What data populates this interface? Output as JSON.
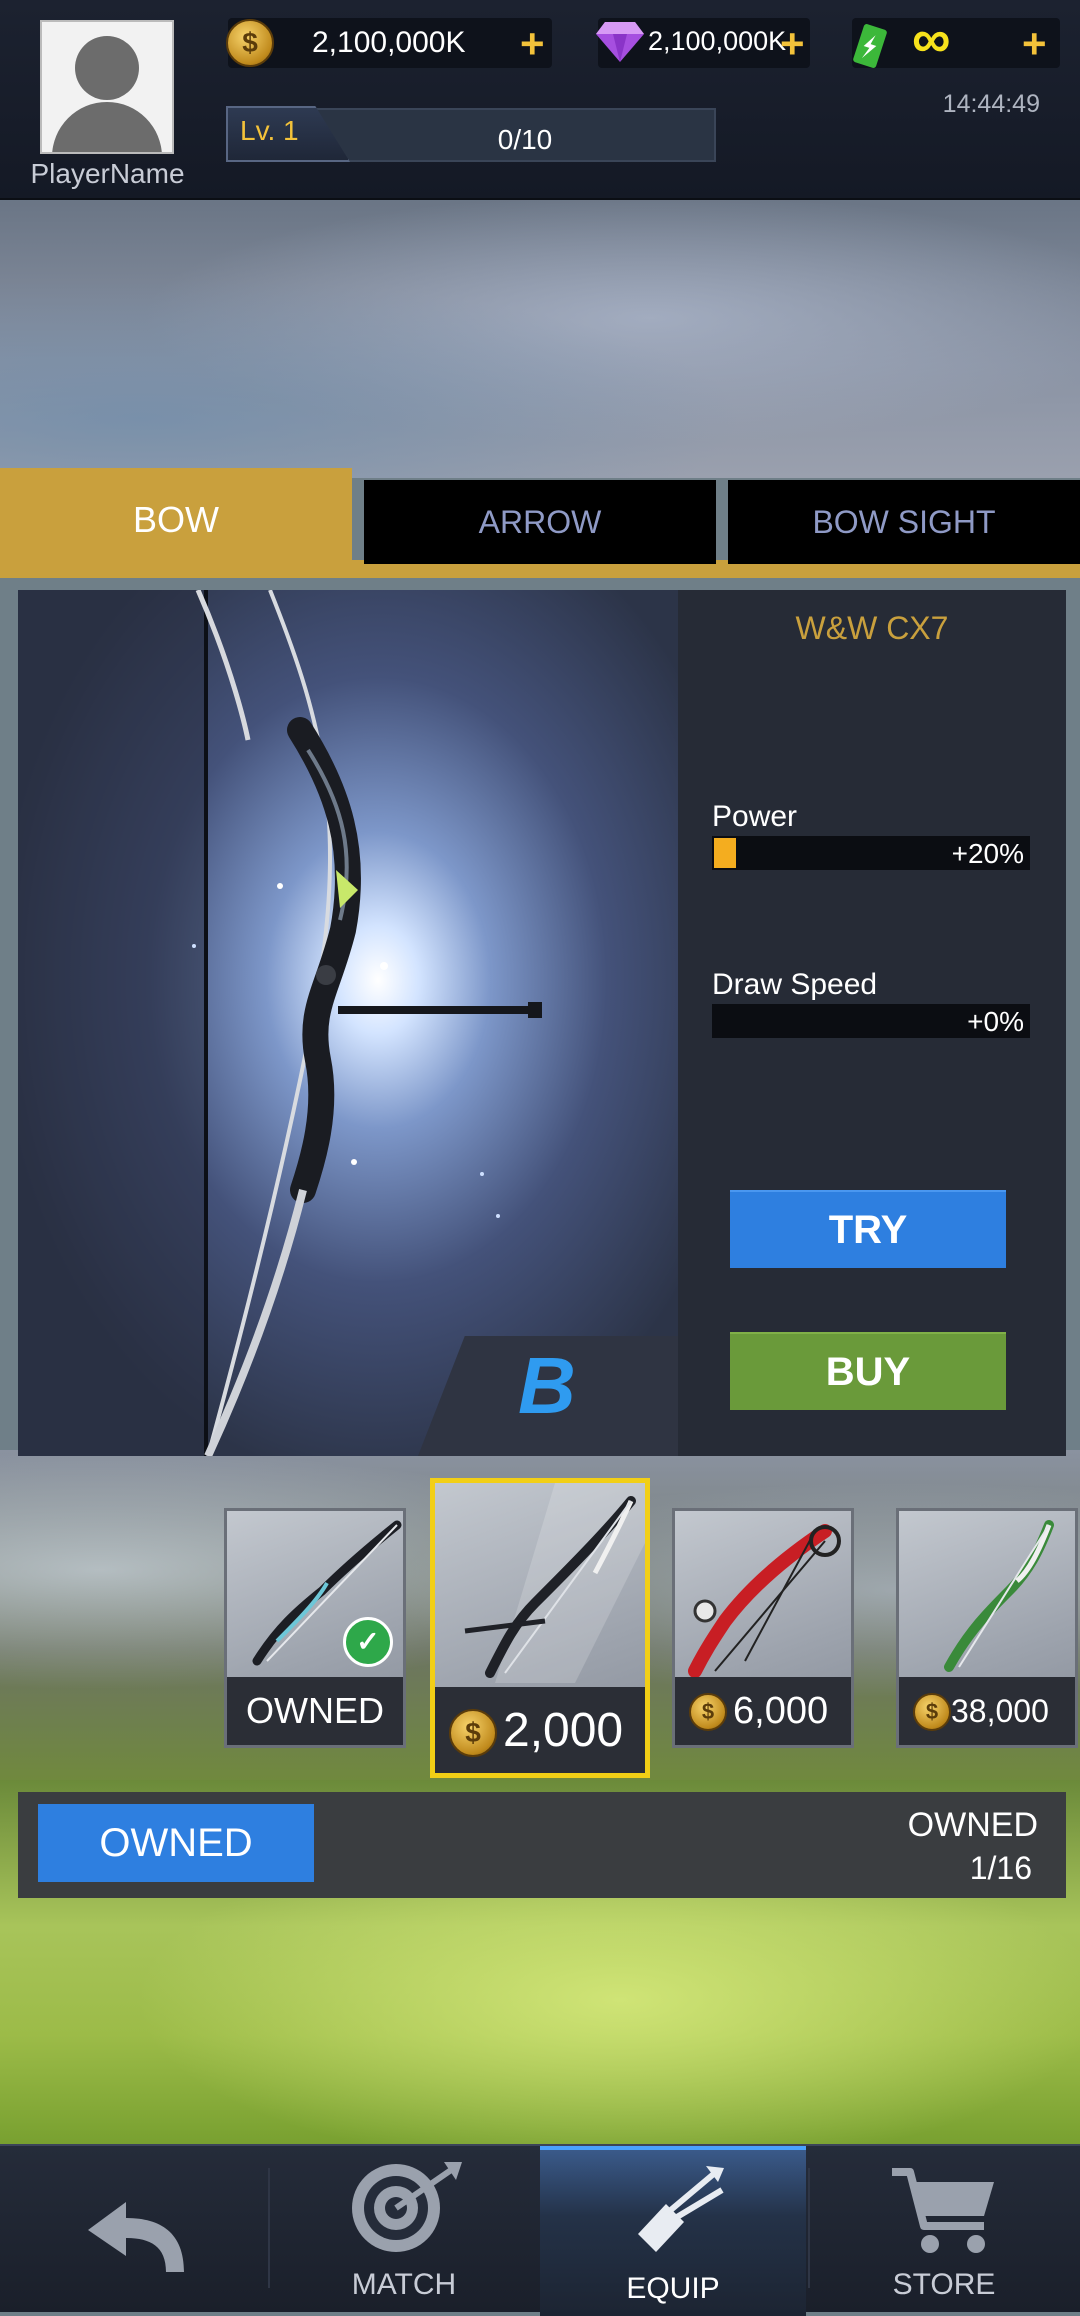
{
  "header": {
    "player_name": "PlayerName",
    "coins": "2,100,000K",
    "gems": "2,100,000K",
    "energy": "∞",
    "clock": "14:44:49",
    "level_label": "Lv. 1",
    "level_progress": "0/10",
    "plus_label": "+",
    "coin_symbol": "$"
  },
  "tabs": [
    {
      "label": "BOW",
      "active": true
    },
    {
      "label": "ARROW",
      "active": false
    },
    {
      "label": "BOW SIGHT",
      "active": false
    }
  ],
  "item": {
    "name": "W&W CX7",
    "grade": "B",
    "stats": [
      {
        "label": "Power",
        "value": "+20%",
        "level": 0.07
      },
      {
        "label": "Draw Speed",
        "value": "+0%",
        "level": 0.0
      }
    ],
    "try_label": "TRY",
    "buy_label": "BUY"
  },
  "cards": [
    {
      "label": "OWNED",
      "owned": true
    },
    {
      "price": "2,000",
      "selected": true
    },
    {
      "price": "6,000"
    },
    {
      "price": "38,000"
    }
  ],
  "owned_bar": {
    "button_label": "OWNED",
    "label": "OWNED",
    "count": "1/16"
  },
  "nav": {
    "match": "MATCH",
    "equip": "EQUIP",
    "store": "STORE"
  },
  "colors": {
    "accent_gold": "#c9a03d",
    "try_blue": "#2e7fe0",
    "buy_green": "#6a9a3a",
    "selected_border": "#f2cf16"
  }
}
